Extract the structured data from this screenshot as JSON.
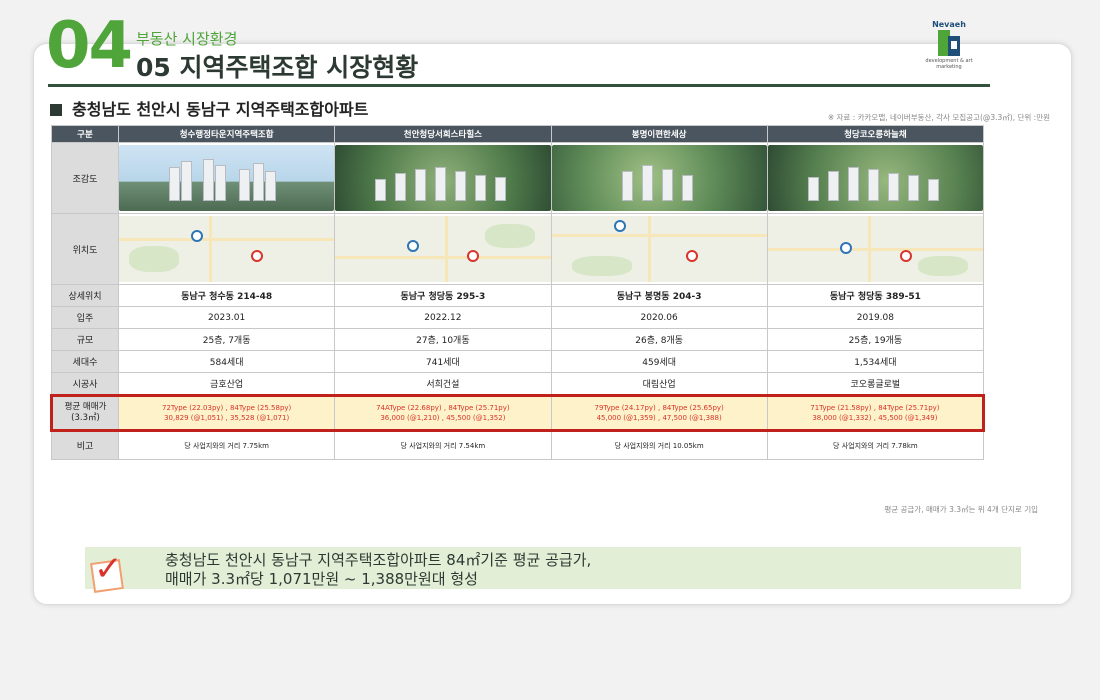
{
  "header": {
    "section_number": "04",
    "section_subtitle": "부동산 시장환경",
    "section_title": "05 지역주택조합 시장현황"
  },
  "logo": {
    "name": "Nevaeh",
    "tagline": "development & art marketing"
  },
  "subhead": "충청남도 천안시 동남구 지역주택조합아파트",
  "source_note": "※ 자료 : 카카오맵, 네이버부동산, 각사 모집공고(@3.3㎡), 단위 :만원",
  "table": {
    "corner_header": "구분",
    "columns": [
      "청수행정타운지역주택조합",
      "천안청당서희스타힐스",
      "봉명이편한세상",
      "청당코오롱하늘채"
    ],
    "photo_label": "조감도",
    "map_label": "위치도",
    "rows": [
      {
        "label": "상세위치",
        "values": [
          "동남구 청수동 214-48",
          "동남구 청당동 295-3",
          "동남구 봉명동 204-3",
          "동남구 청당동 389-51"
        ]
      },
      {
        "label": "입주",
        "values": [
          "2023.01",
          "2022.12",
          "2020.06",
          "2019.08"
        ]
      },
      {
        "label": "규모",
        "values": [
          "25층, 7개동",
          "27층, 10개동",
          "26층, 8개동",
          "25층, 19개동"
        ]
      },
      {
        "label": "세대수",
        "values": [
          "584세대",
          "741세대",
          "459세대",
          "1,534세대"
        ]
      },
      {
        "label": "시공사",
        "values": [
          "금호산업",
          "서희건설",
          "대림산업",
          "코오롱글로벌"
        ]
      }
    ],
    "price": {
      "label_line1": "평균 매매가",
      "label_line2": "(3.3㎡)",
      "values": [
        {
          "line1": "72Type (22.03py)  ,  84Type (25.58py)",
          "line2": "30,829 (@1,051)  ,  35,528 (@1,071)"
        },
        {
          "line1": "74AType (22.68py)  ,  84Type (25.71py)",
          "line2": "36,000 (@1,210)  ,  45,500 (@1,352)"
        },
        {
          "line1": "79Type (24.17py)  ,  84Type (25.65py)",
          "line2": "45,000 (@1,359)  ,  47,500 (@1,388)"
        },
        {
          "line1": "71Type (21.58py)  ,  84Type (25.71py)",
          "line2": "38,000 (@1,332)  ,  45,500 (@1,349)"
        }
      ]
    },
    "note": {
      "label": "비고",
      "values": [
        "당 사업지와의 거리 7.75km",
        "당 사업지와의 거리 7.54km",
        "당 사업지와의 거리 10.05km",
        "당 사업지와의 거리 7.78km"
      ]
    }
  },
  "footnote": "평균 공급가, 매매가 3.3㎡는 위 4개 단지로 기입",
  "summary": {
    "line1": "충청남도 천안시 동남구 지역주택조합아파트 84㎡기준 평균 공급가,",
    "line2": "매매가 3.3㎡당 1,071만원 ~ 1,388만원대 형성"
  },
  "colors": {
    "accent_green": "#4fa43a",
    "header_dark": "#4a5560",
    "highlight_red": "#d9342b",
    "summary_bg": "#e2efd6"
  }
}
